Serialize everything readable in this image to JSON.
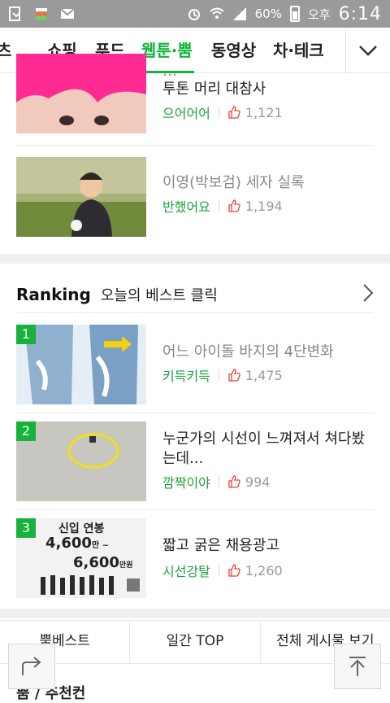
{
  "status": {
    "battery_text": "60%",
    "ampm": "오후",
    "time": "6:14"
  },
  "tabs": [
    "츠",
    "쇼핑",
    "푸드",
    "웹툰·뿜",
    "동영상",
    "차·테크"
  ],
  "top_list": [
    {
      "title": "투톤 머리 대참사",
      "nick": "으어어어",
      "likes": "1,121"
    },
    {
      "title": "이영(박보검) 세자 실록",
      "nick": "반했어요",
      "likes": "1,194"
    }
  ],
  "ranking": {
    "title": "Ranking",
    "subtitle": "오늘의 베스트 클릭",
    "items": [
      {
        "rank": "1",
        "title": "어느 아이돌 바지의 4단변화",
        "nick": "키득키득",
        "likes": "1,475"
      },
      {
        "rank": "2",
        "title": "누군가의 시선이 느껴져서 쳐다봤는데...",
        "nick": "깜짝이야",
        "likes": "994"
      },
      {
        "rank": "3",
        "title": "짧고 굵은 채용광고",
        "nick": "시선강탈",
        "likes": "1,260",
        "thumb_line1": "신입 연봉",
        "thumb_line2": "4,600",
        "thumb_line2_unit": "만 ~",
        "thumb_line3": "6,600",
        "thumb_line3_unit": "만원"
      }
    ]
  },
  "footer_tabs": [
    "뿜베스트",
    "일간 TOP",
    "전체 게시물 보기"
  ],
  "bottom_cut_text": "뿜 / 추천컨",
  "icons": {
    "like": "thumbs-up-outline-icon",
    "more": "chevron-down-icon",
    "ranking_more": "chevron-right-icon",
    "share": "share-icon",
    "top": "scroll-top-icon"
  },
  "colors": {
    "accent": "#10b53b"
  }
}
